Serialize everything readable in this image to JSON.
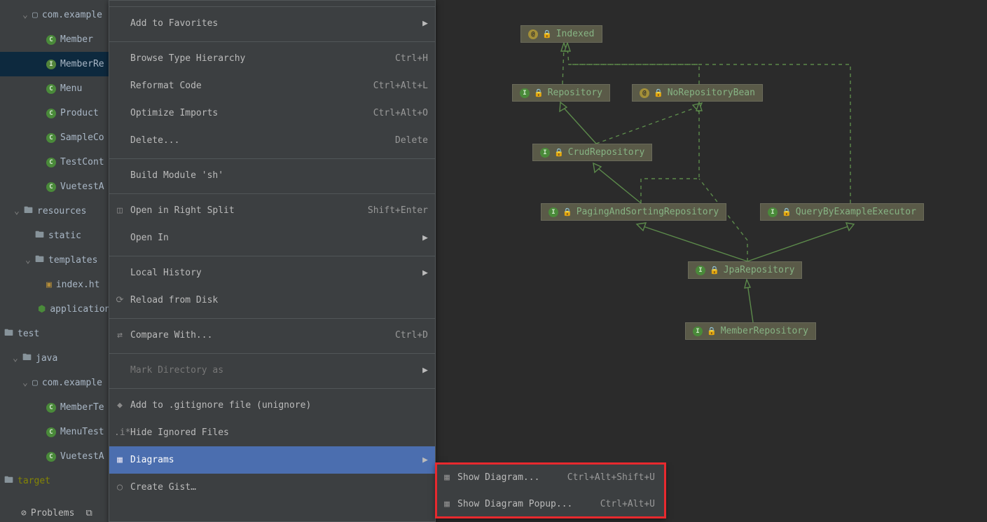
{
  "tree": {
    "pkg": "com.example",
    "files": [
      "Member",
      "MemberRe",
      "Menu",
      "Product",
      "SampleCo",
      "TestCont",
      "VuetestA"
    ],
    "resources": "resources",
    "static": "static",
    "templates": "templates",
    "index": "index.ht",
    "app": "application",
    "test": "test",
    "java": "java",
    "pkg2": "com.example",
    "tests": [
      "MemberTe",
      "MenuTest",
      "VuetestA"
    ],
    "target": "target",
    "problems": "Problems"
  },
  "ctx": {
    "add_fav": "Add to Favorites",
    "browse": "Browse Type Hierarchy",
    "browse_sc": "Ctrl+H",
    "reformat": "Reformat Code",
    "reformat_sc": "Ctrl+Alt+L",
    "optimize": "Optimize Imports",
    "optimize_sc": "Ctrl+Alt+O",
    "delete": "Delete...",
    "delete_sc": "Delete",
    "build": "Build Module 'sh'",
    "split": "Open in Right Split",
    "split_sc": "Shift+Enter",
    "openin": "Open In",
    "history": "Local History",
    "reload": "Reload from Disk",
    "compare": "Compare With...",
    "compare_sc": "Ctrl+D",
    "markdir": "Mark Directory as",
    "gitignore": "Add to .gitignore file (unignore)",
    "hideign": "Hide Ignored Files",
    "diagrams": "Diagrams",
    "gist": "Create Gist…"
  },
  "sub": {
    "show": "Show Diagram...",
    "show_sc": "Ctrl+Alt+Shift+U",
    "popup": "Show Diagram Popup...",
    "popup_sc": "Ctrl+Alt+U"
  },
  "diag": {
    "indexed": "Indexed",
    "repository": "Repository",
    "norepo": "NoRepositoryBean",
    "crud": "CrudRepository",
    "paging": "PagingAndSortingRepository",
    "query": "QueryByExampleExecutor",
    "jpa": "JpaRepository",
    "member": "MemberRepository"
  }
}
